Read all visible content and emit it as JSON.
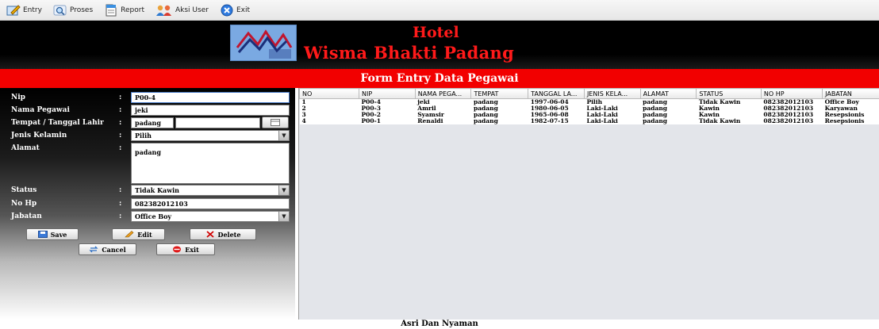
{
  "menu": [
    {
      "label": "Entry",
      "icon": "entry-icon"
    },
    {
      "label": "Proses",
      "icon": "magnifier-icon"
    },
    {
      "label": "Report",
      "icon": "report-icon"
    },
    {
      "label": "Aksi User",
      "icon": "users-icon"
    },
    {
      "label": "Exit",
      "icon": "close-icon"
    }
  ],
  "banner": {
    "line1": "Hotel",
    "line2": "Wisma Bhakti Padang"
  },
  "form": {
    "title": "Form Entry Data Pegawai",
    "colon": ":",
    "nip": {
      "label": "Nip",
      "value": "P00-4"
    },
    "nama": {
      "label": "Nama Pegawai",
      "value": "jeki"
    },
    "ttl": {
      "label": "Tempat / Tanggal Lahir",
      "value": "padang",
      "date": ""
    },
    "jk": {
      "label": "Jenis Kelamin",
      "value": "Pilih"
    },
    "alamat": {
      "label": "Alamat",
      "value": "padang"
    },
    "status": {
      "label": "Status",
      "value": "Tidak Kawin"
    },
    "nohp": {
      "label": "No Hp",
      "value": "082382012103"
    },
    "jabatan": {
      "label": "Jabatan",
      "value": "Office Boy"
    }
  },
  "buttons": {
    "save": "Save",
    "edit": "Edit",
    "delete": "Delete",
    "cancel": "Cancel",
    "exit": "Exit"
  },
  "table": {
    "headers": [
      "NO",
      "NIP",
      "NAMA PEGA...",
      "TEMPAT",
      "TANGGAL LA...",
      "JENIS KELA...",
      "ALAMAT",
      "STATUS",
      "NO HP",
      "JABATAN"
    ],
    "rows": [
      [
        "1",
        "P00-4",
        "jeki",
        "padang",
        "1997-06-04",
        "Pilih",
        "padang",
        "Tidak Kawin",
        "082382012103",
        "Office Boy"
      ],
      [
        "2",
        "P00-3",
        "Amril",
        "padang",
        "1980-06-05",
        "Laki-Laki",
        "padang",
        "Kawin",
        "082382012103",
        "Karyawan"
      ],
      [
        "3",
        "P00-2",
        "Syamsir",
        "padang",
        "1965-06-08",
        "Laki-Laki",
        "padang",
        "Kawin",
        "082382012103",
        "Resepsionis"
      ],
      [
        "4",
        "P00-1",
        "Renaldi",
        "padang",
        "1982-07-15",
        "Laki-Laki",
        "padang",
        "Tidak Kawin",
        "082382012103",
        "Resepsionis"
      ]
    ]
  },
  "footer": "Asri Dan Nyaman",
  "colors": {
    "accent": "#f20000",
    "title_text": "#ff1a1a"
  }
}
